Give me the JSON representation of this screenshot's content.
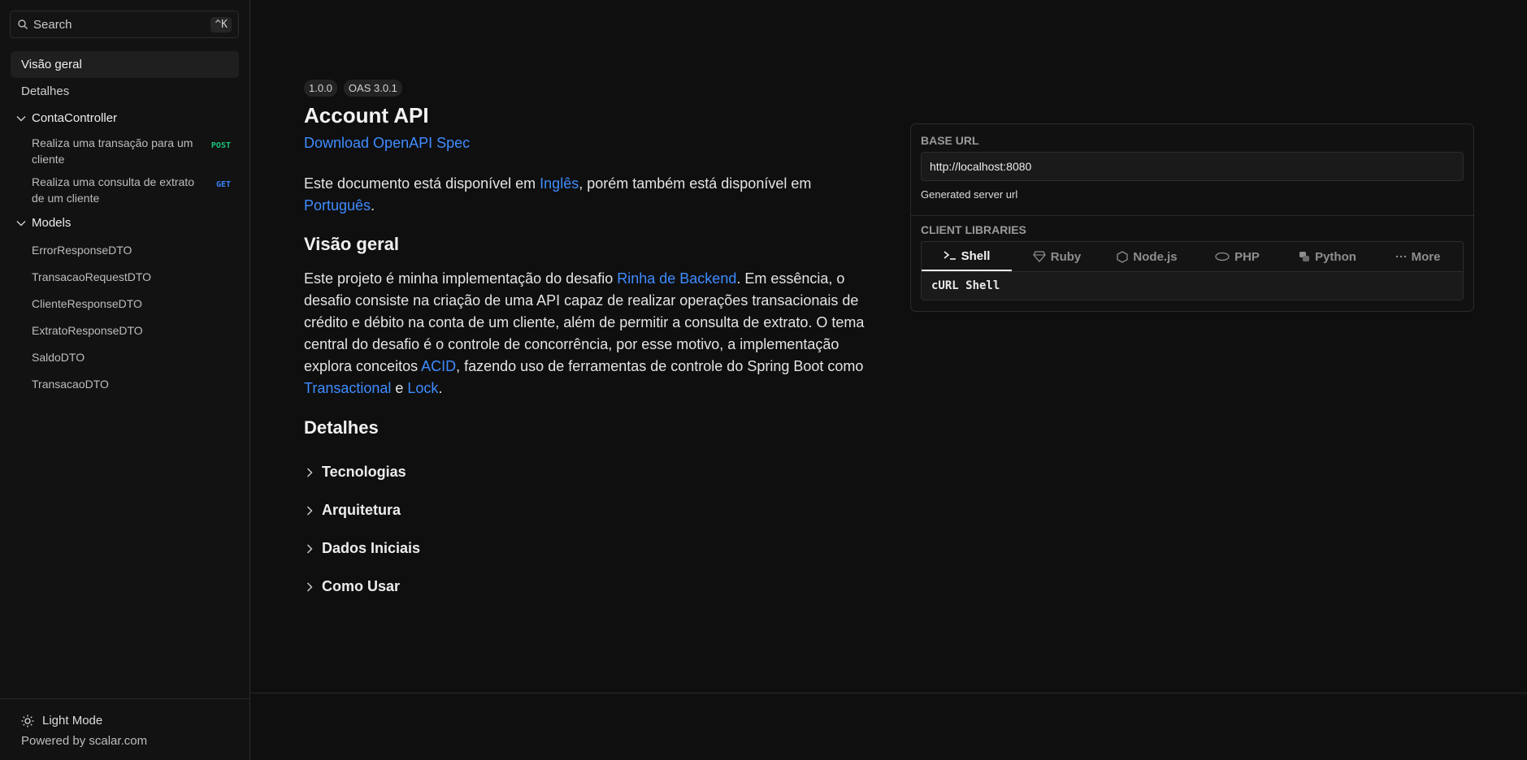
{
  "search": {
    "placeholder": "Search",
    "shortcut": "^K"
  },
  "sidebar": {
    "overview": "Visão geral",
    "details": "Detalhes",
    "groups": [
      {
        "label": "ContaController",
        "ops": [
          {
            "label": "Realiza uma transação para um cliente",
            "method": "POST"
          },
          {
            "label": "Realiza uma consulta de extrato de um cliente",
            "method": "GET"
          }
        ]
      },
      {
        "label": "Models",
        "items": [
          "ErrorResponseDTO",
          "TransacaoRequestDTO",
          "ClienteResponseDTO",
          "ExtratoResponseDTO",
          "SaldoDTO",
          "TransacaoDTO"
        ]
      }
    ],
    "footer": {
      "mode": "Light Mode",
      "powered": "Powered by scalar.com"
    }
  },
  "main": {
    "version": "1.0.0",
    "oas": "OAS 3.0.1",
    "title": "Account API",
    "download": "Download OpenAPI Spec",
    "intro": {
      "t1": "Este documento está disponível em ",
      "link1": "Inglês",
      "t2": ", porém também está disponível em ",
      "link2": "Português",
      "t3": "."
    },
    "overview_heading": "Visão geral",
    "overview": {
      "t1": "Este projeto é minha implementação do desafio ",
      "link1": "Rinha de Backend",
      "t2": ". Em essência, o desafio consiste na criação de uma API capaz de realizar operações transacionais de crédito e débito na conta de um cliente, além de permitir a consulta de extrato. O tema central do desafio é o controle de concorrência, por esse motivo, a implementação explora conceitos ",
      "link2": "ACID",
      "t3": ", fazendo uso de ferramentas de controle do Spring Boot como ",
      "link3": "Transactional",
      "t4": " e ",
      "link4": "Lock",
      "t5": "."
    },
    "details_heading": "Detalhes",
    "sections": [
      "Tecnologias",
      "Arquitetura",
      "Dados Iniciais",
      "Como Usar"
    ]
  },
  "panel": {
    "base_url_label": "BASE URL",
    "base_url": "http://localhost:8080",
    "base_url_desc": "Generated server url",
    "client_label": "CLIENT LIBRARIES",
    "tabs": [
      {
        "label": "Shell",
        "icon": "terminal-icon"
      },
      {
        "label": "Ruby",
        "icon": "ruby-icon"
      },
      {
        "label": "Node.js",
        "icon": "nodejs-icon"
      },
      {
        "label": "PHP",
        "icon": "php-icon"
      },
      {
        "label": "Python",
        "icon": "python-icon"
      },
      {
        "label": "More",
        "icon": "more-icon"
      }
    ],
    "code": "cURL Shell"
  },
  "colors": {
    "link": "#3f8cff",
    "post": "#19c37d",
    "get": "#3b82f6",
    "background": "#0f0f0f"
  }
}
